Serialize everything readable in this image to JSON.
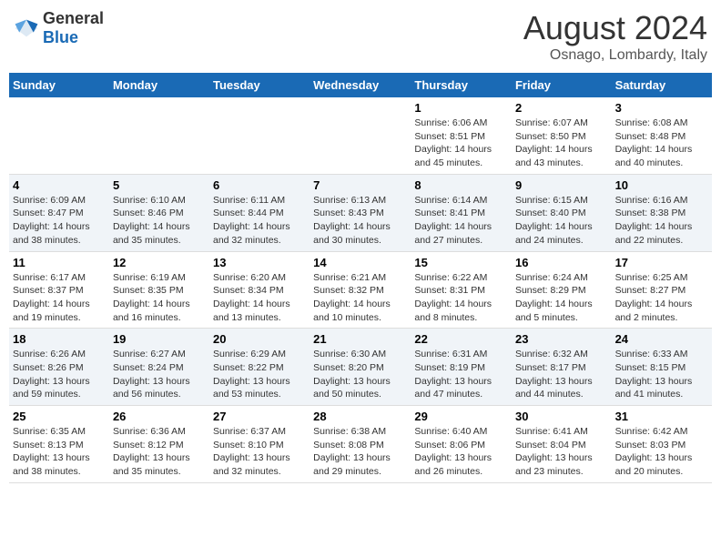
{
  "header": {
    "logo_general": "General",
    "logo_blue": "Blue",
    "month_year": "August 2024",
    "location": "Osnago, Lombardy, Italy"
  },
  "weekdays": [
    "Sunday",
    "Monday",
    "Tuesday",
    "Wednesday",
    "Thursday",
    "Friday",
    "Saturday"
  ],
  "weeks": [
    [
      {
        "day": "",
        "info": ""
      },
      {
        "day": "",
        "info": ""
      },
      {
        "day": "",
        "info": ""
      },
      {
        "day": "",
        "info": ""
      },
      {
        "day": "1",
        "info": "Sunrise: 6:06 AM\nSunset: 8:51 PM\nDaylight: 14 hours\nand 45 minutes."
      },
      {
        "day": "2",
        "info": "Sunrise: 6:07 AM\nSunset: 8:50 PM\nDaylight: 14 hours\nand 43 minutes."
      },
      {
        "day": "3",
        "info": "Sunrise: 6:08 AM\nSunset: 8:48 PM\nDaylight: 14 hours\nand 40 minutes."
      }
    ],
    [
      {
        "day": "4",
        "info": "Sunrise: 6:09 AM\nSunset: 8:47 PM\nDaylight: 14 hours\nand 38 minutes."
      },
      {
        "day": "5",
        "info": "Sunrise: 6:10 AM\nSunset: 8:46 PM\nDaylight: 14 hours\nand 35 minutes."
      },
      {
        "day": "6",
        "info": "Sunrise: 6:11 AM\nSunset: 8:44 PM\nDaylight: 14 hours\nand 32 minutes."
      },
      {
        "day": "7",
        "info": "Sunrise: 6:13 AM\nSunset: 8:43 PM\nDaylight: 14 hours\nand 30 minutes."
      },
      {
        "day": "8",
        "info": "Sunrise: 6:14 AM\nSunset: 8:41 PM\nDaylight: 14 hours\nand 27 minutes."
      },
      {
        "day": "9",
        "info": "Sunrise: 6:15 AM\nSunset: 8:40 PM\nDaylight: 14 hours\nand 24 minutes."
      },
      {
        "day": "10",
        "info": "Sunrise: 6:16 AM\nSunset: 8:38 PM\nDaylight: 14 hours\nand 22 minutes."
      }
    ],
    [
      {
        "day": "11",
        "info": "Sunrise: 6:17 AM\nSunset: 8:37 PM\nDaylight: 14 hours\nand 19 minutes."
      },
      {
        "day": "12",
        "info": "Sunrise: 6:19 AM\nSunset: 8:35 PM\nDaylight: 14 hours\nand 16 minutes."
      },
      {
        "day": "13",
        "info": "Sunrise: 6:20 AM\nSunset: 8:34 PM\nDaylight: 14 hours\nand 13 minutes."
      },
      {
        "day": "14",
        "info": "Sunrise: 6:21 AM\nSunset: 8:32 PM\nDaylight: 14 hours\nand 10 minutes."
      },
      {
        "day": "15",
        "info": "Sunrise: 6:22 AM\nSunset: 8:31 PM\nDaylight: 14 hours\nand 8 minutes."
      },
      {
        "day": "16",
        "info": "Sunrise: 6:24 AM\nSunset: 8:29 PM\nDaylight: 14 hours\nand 5 minutes."
      },
      {
        "day": "17",
        "info": "Sunrise: 6:25 AM\nSunset: 8:27 PM\nDaylight: 14 hours\nand 2 minutes."
      }
    ],
    [
      {
        "day": "18",
        "info": "Sunrise: 6:26 AM\nSunset: 8:26 PM\nDaylight: 13 hours\nand 59 minutes."
      },
      {
        "day": "19",
        "info": "Sunrise: 6:27 AM\nSunset: 8:24 PM\nDaylight: 13 hours\nand 56 minutes."
      },
      {
        "day": "20",
        "info": "Sunrise: 6:29 AM\nSunset: 8:22 PM\nDaylight: 13 hours\nand 53 minutes."
      },
      {
        "day": "21",
        "info": "Sunrise: 6:30 AM\nSunset: 8:20 PM\nDaylight: 13 hours\nand 50 minutes."
      },
      {
        "day": "22",
        "info": "Sunrise: 6:31 AM\nSunset: 8:19 PM\nDaylight: 13 hours\nand 47 minutes."
      },
      {
        "day": "23",
        "info": "Sunrise: 6:32 AM\nSunset: 8:17 PM\nDaylight: 13 hours\nand 44 minutes."
      },
      {
        "day": "24",
        "info": "Sunrise: 6:33 AM\nSunset: 8:15 PM\nDaylight: 13 hours\nand 41 minutes."
      }
    ],
    [
      {
        "day": "25",
        "info": "Sunrise: 6:35 AM\nSunset: 8:13 PM\nDaylight: 13 hours\nand 38 minutes."
      },
      {
        "day": "26",
        "info": "Sunrise: 6:36 AM\nSunset: 8:12 PM\nDaylight: 13 hours\nand 35 minutes."
      },
      {
        "day": "27",
        "info": "Sunrise: 6:37 AM\nSunset: 8:10 PM\nDaylight: 13 hours\nand 32 minutes."
      },
      {
        "day": "28",
        "info": "Sunrise: 6:38 AM\nSunset: 8:08 PM\nDaylight: 13 hours\nand 29 minutes."
      },
      {
        "day": "29",
        "info": "Sunrise: 6:40 AM\nSunset: 8:06 PM\nDaylight: 13 hours\nand 26 minutes."
      },
      {
        "day": "30",
        "info": "Sunrise: 6:41 AM\nSunset: 8:04 PM\nDaylight: 13 hours\nand 23 minutes."
      },
      {
        "day": "31",
        "info": "Sunrise: 6:42 AM\nSunset: 8:03 PM\nDaylight: 13 hours\nand 20 minutes."
      }
    ]
  ]
}
